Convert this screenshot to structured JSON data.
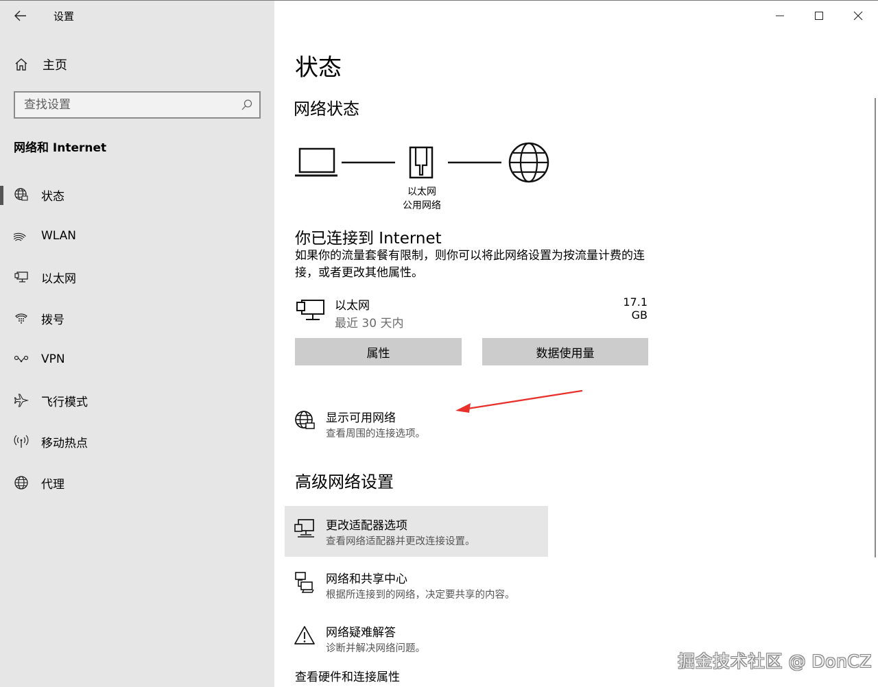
{
  "window": {
    "title": "设置"
  },
  "sidebar": {
    "home_label": "主页",
    "search_placeholder": "查找设置",
    "section_title": "网络和 Internet",
    "items": [
      {
        "label": "状态",
        "icon": "globe-status-icon",
        "selected": true
      },
      {
        "label": "WLAN",
        "icon": "wifi-icon",
        "selected": false
      },
      {
        "label": "以太网",
        "icon": "ethernet-icon",
        "selected": false
      },
      {
        "label": "拨号",
        "icon": "dialup-icon",
        "selected": false
      },
      {
        "label": "VPN",
        "icon": "vpn-icon",
        "selected": false
      },
      {
        "label": "飞行模式",
        "icon": "airplane-icon",
        "selected": false
      },
      {
        "label": "移动热点",
        "icon": "hotspot-icon",
        "selected": false
      },
      {
        "label": "代理",
        "icon": "globe-icon",
        "selected": false
      }
    ]
  },
  "main": {
    "title": "状态",
    "network_status_heading": "网络状态",
    "diagram": {
      "adapter_label": "以太网",
      "network_type": "公用网络"
    },
    "connected_title": "你已连接到 Internet",
    "connected_desc": "如果你的流量套餐有限制，则你可以将此网络设置为按流量计费的连接，或者更改其他属性。",
    "adapter": {
      "name": "以太网",
      "period": "最近 30 天内",
      "usage": "17.1 GB"
    },
    "buttons": {
      "properties": "属性",
      "data_usage": "数据使用量"
    },
    "show_networks": {
      "title": "显示可用网络",
      "subtitle": "查看周围的连接选项。"
    },
    "advanced_heading": "高级网络设置",
    "advanced_links": [
      {
        "title": "更改适配器选项",
        "subtitle": "查看网络适配器并更改连接设置。"
      },
      {
        "title": "网络和共享中心",
        "subtitle": "根据所连接到的网络，决定要共享的内容。"
      },
      {
        "title": "网络疑难解答",
        "subtitle": "诊断并解决网络问题。"
      }
    ],
    "bottom_link": "查看硬件和连接属性"
  },
  "watermark": "掘金技术社区 @ DonCZ",
  "colors": {
    "sidebar_bg": "#e6e6e6",
    "button_bg": "#cccccc",
    "arrow": "#e8312a"
  }
}
